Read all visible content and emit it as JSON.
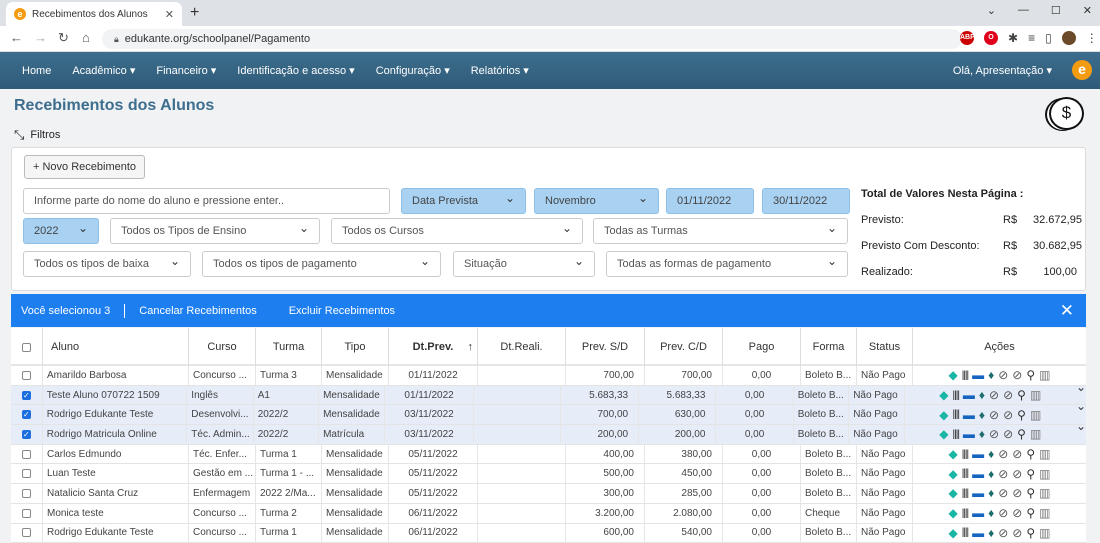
{
  "browser": {
    "tab_title": "Recebimentos dos Alunos",
    "url": "edukante.org/schoolpanel/Pagamento"
  },
  "nav": {
    "items": [
      "Home",
      "Acadêmico ▾",
      "Financeiro ▾",
      "Identificação e acesso ▾",
      "Configuração ▾",
      "Relatórios ▾"
    ],
    "greeting": "Olá, Apresentação ▾",
    "brand": "e"
  },
  "page": {
    "title": "Recebimentos dos Alunos",
    "filters_label": "Filtros",
    "new_button": "+ Novo Recebimento"
  },
  "filters": {
    "search_placeholder": "Informe parte do nome do aluno e pressione enter..",
    "date_type": "Data Prevista",
    "month": "Novembro",
    "date_from": "01/11/2022",
    "date_to": "30/11/2022",
    "year": "2022",
    "tipos_ensino": "Todos os Tipos de Ensino",
    "cursos": "Todos os Cursos",
    "turmas": "Todas as Turmas",
    "tipos_baixa": "Todos os tipos de baixa",
    "tipos_pagamento": "Todos os tipos de pagamento",
    "situacao": "Situação",
    "formas_pagamento": "Todas as formas de pagamento"
  },
  "totals": {
    "title": "Total de Valores Nesta Página :",
    "rows": [
      {
        "label": "Previsto:",
        "currency": "R$",
        "value": "32.672,95"
      },
      {
        "label": "Previsto Com Desconto:",
        "currency": "R$",
        "value": "30.682,95"
      },
      {
        "label": "Realizado:",
        "currency": "R$",
        "value": "100,00"
      }
    ]
  },
  "selection_bar": {
    "selected_text": "Você selecionou 3",
    "cancel": "Cancelar Recebimentos",
    "delete": "Excluir Recebimentos",
    "close": "✕"
  },
  "table": {
    "headers": [
      "",
      "Aluno",
      "Curso",
      "Turma",
      "Tipo",
      "Dt.Prev.",
      "Dt.Reali.",
      "Prev. S/D",
      "Prev. C/D",
      "Pago",
      "Forma",
      "Status",
      "Ações"
    ],
    "sort_indicator": "↑",
    "rows": [
      {
        "checked": false,
        "aluno": "Amarildo Barbosa",
        "curso": "Concurso ...",
        "turma": "Turma 3",
        "tipo": "Mensalidade",
        "dtprev": "01/11/2022",
        "dtreal": "",
        "prevsd": "700,00",
        "prevcd": "700,00",
        "pago": "0,00",
        "forma": "Boleto B...",
        "status": "Não Pago"
      },
      {
        "checked": true,
        "aluno": "Teste Aluno 070722 1509",
        "curso": "Inglês",
        "turma": "A1",
        "tipo": "Mensalidade",
        "dtprev": "01/11/2022",
        "dtreal": "",
        "prevsd": "5.683,33",
        "prevcd": "5.683,33",
        "pago": "0,00",
        "forma": "Boleto B...",
        "status": "Não Pago"
      },
      {
        "checked": true,
        "aluno": "Rodrigo Edukante Teste",
        "curso": "Desenvolvi...",
        "turma": "2022/2",
        "tipo": "Mensalidade",
        "dtprev": "03/11/2022",
        "dtreal": "",
        "prevsd": "700,00",
        "prevcd": "630,00",
        "pago": "0,00",
        "forma": "Boleto B...",
        "status": "Não Pago"
      },
      {
        "checked": true,
        "aluno": "Rodrigo Matricula Online",
        "curso": "Téc. Admin...",
        "turma": "2022/2",
        "tipo": "Matrícula",
        "dtprev": "03/11/2022",
        "dtreal": "",
        "prevsd": "200,00",
        "prevcd": "200,00",
        "pago": "0,00",
        "forma": "Boleto B...",
        "status": "Não Pago"
      },
      {
        "checked": false,
        "aluno": "Carlos Edmundo",
        "curso": "Téc. Enfer...",
        "turma": "Turma 1",
        "tipo": "Mensalidade",
        "dtprev": "05/11/2022",
        "dtreal": "",
        "prevsd": "400,00",
        "prevcd": "380,00",
        "pago": "0,00",
        "forma": "Boleto B...",
        "status": "Não Pago"
      },
      {
        "checked": false,
        "aluno": "Luan Teste",
        "curso": "Gestão em ...",
        "turma": "Turma 1 - ...",
        "tipo": "Mensalidade",
        "dtprev": "05/11/2022",
        "dtreal": "",
        "prevsd": "500,00",
        "prevcd": "450,00",
        "pago": "0,00",
        "forma": "Boleto B...",
        "status": "Não Pago"
      },
      {
        "checked": false,
        "aluno": "Natalicio Santa Cruz",
        "curso": "Enfermagem",
        "turma": "2022 2/Ma...",
        "tipo": "Mensalidade",
        "dtprev": "05/11/2022",
        "dtreal": "",
        "prevsd": "300,00",
        "prevcd": "285,00",
        "pago": "0,00",
        "forma": "Boleto B...",
        "status": "Não Pago"
      },
      {
        "checked": false,
        "aluno": "Monica teste",
        "curso": "Concurso ...",
        "turma": "Turma 2",
        "tipo": "Mensalidade",
        "dtprev": "06/11/2022",
        "dtreal": "",
        "prevsd": "3.200,00",
        "prevcd": "2.080,00",
        "pago": "0,00",
        "forma": "Cheque",
        "status": "Não Pago"
      },
      {
        "checked": false,
        "aluno": "Rodrigo Edukante Teste",
        "curso": "Concurso ...",
        "turma": "Turma 1",
        "tipo": "Mensalidade",
        "dtprev": "06/11/2022",
        "dtreal": "",
        "prevsd": "600,00",
        "prevcd": "540,00",
        "pago": "0,00",
        "forma": "Boleto B...",
        "status": "Não Pago"
      }
    ]
  },
  "action_icons": [
    "diamond-icon",
    "barcode-icon",
    "card-icon",
    "gem-icon",
    "link-icon",
    "link-icon",
    "search-icon",
    "trash-icon"
  ]
}
